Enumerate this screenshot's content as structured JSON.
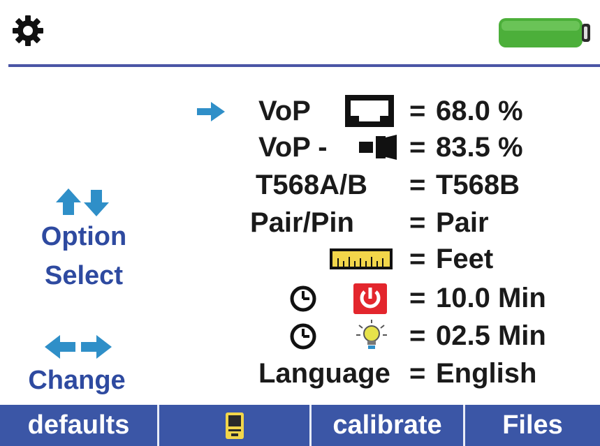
{
  "header": {
    "settings_icon": "gear-icon",
    "battery_icon": "battery-full-icon",
    "battery_level": 1.0,
    "battery_color": "#4caf3a",
    "divider_color": "#4a55a5"
  },
  "hints": {
    "option_select": {
      "icon": "up-down-arrows-icon",
      "line1": "Option",
      "line2": "Select"
    },
    "change": {
      "icon": "left-right-arrows-icon",
      "label": "Change"
    },
    "text_color": "#2e4aa0",
    "arrow_color": "#2f8fc8"
  },
  "settings": {
    "cursor_icon": "right-arrow-cursor-icon",
    "rows": [
      {
        "label": "VoP",
        "icon": "rj45-port-icon",
        "value": "68.0 %"
      },
      {
        "label": "VoP -",
        "icon": "coax-connector-icon",
        "value": "83.5 %"
      },
      {
        "label": "T568A/B",
        "value": "T568B"
      },
      {
        "label": "Pair/Pin",
        "value": "Pair"
      },
      {
        "icon": "ruler-icon",
        "value": "Feet"
      },
      {
        "icons": [
          "clock-icon",
          "power-icon"
        ],
        "value": "10.0 Min"
      },
      {
        "icons": [
          "clock-icon",
          "backlight-bulb-icon"
        ],
        "value": "02.5 Min"
      },
      {
        "label": "Language",
        "value": "English"
      }
    ],
    "equals": "="
  },
  "footer": {
    "buttons": [
      {
        "label": "defaults"
      },
      {
        "icon": "device-icon"
      },
      {
        "label": "calibrate"
      },
      {
        "label": "Files"
      }
    ],
    "bar_color": "#3b56a6"
  }
}
